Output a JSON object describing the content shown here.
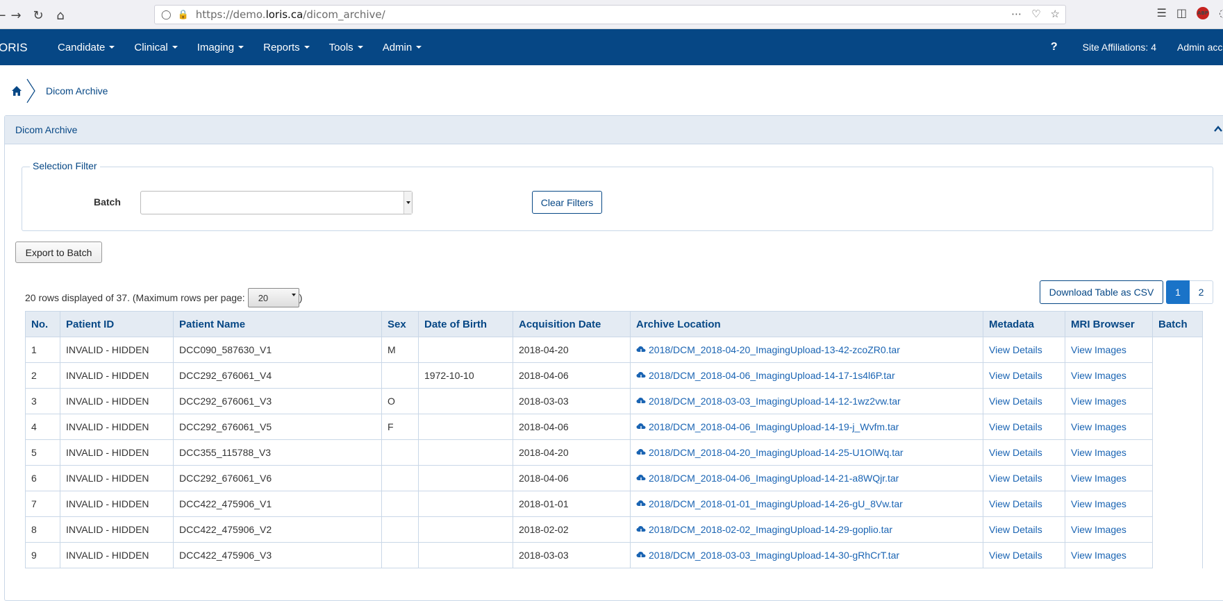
{
  "browser": {
    "url_prefix": "https://demo.",
    "url_domain": "loris.ca",
    "url_path": "/dicom_archive/",
    "abp_label": "ABP"
  },
  "navbar": {
    "brand": "ORIS",
    "menu": [
      {
        "label": "Candidate"
      },
      {
        "label": "Clinical"
      },
      {
        "label": "Imaging"
      },
      {
        "label": "Reports"
      },
      {
        "label": "Tools"
      },
      {
        "label": "Admin"
      }
    ],
    "help": "?",
    "site_affiliations": "Site Affiliations: 4",
    "admin_account": "Admin account"
  },
  "breadcrumb": {
    "current": "Dicom Archive"
  },
  "panel": {
    "title": "Dicom Archive"
  },
  "filter": {
    "legend": "Selection Filter",
    "batch_label": "Batch",
    "batch_value": "",
    "clear_label": "Clear Filters"
  },
  "export_label": "Export to Batch",
  "rows_info": {
    "prefix": "20 rows displayed of 37. (Maximum rows per page:",
    "per_page": "20",
    "suffix": ")"
  },
  "download_csv": "Download Table as CSV",
  "pagination": {
    "pages": [
      "1",
      "2"
    ],
    "active": "1"
  },
  "table": {
    "headers": [
      "No.",
      "Patient ID",
      "Patient Name",
      "Sex",
      "Date of Birth",
      "Acquisition Date",
      "Archive Location",
      "Metadata",
      "MRI Browser",
      "Batch"
    ],
    "rows": [
      {
        "no": "1",
        "patient_id": "INVALID - HIDDEN",
        "patient_name": "DCC090_587630_V1",
        "sex": "M",
        "dob": "",
        "acq_date": "2018-04-20",
        "archive": "2018/DCM_2018-04-20_ImagingUpload-13-42-zcoZR0.tar",
        "metadata": "View Details",
        "mri": "View Images"
      },
      {
        "no": "2",
        "patient_id": "INVALID - HIDDEN",
        "patient_name": "DCC292_676061_V4",
        "sex": "",
        "dob": "1972-10-10",
        "acq_date": "2018-04-06",
        "archive": "2018/DCM_2018-04-06_ImagingUpload-14-17-1s4l6P.tar",
        "metadata": "View Details",
        "mri": "View Images"
      },
      {
        "no": "3",
        "patient_id": "INVALID - HIDDEN",
        "patient_name": "DCC292_676061_V3",
        "sex": "O",
        "dob": "",
        "acq_date": "2018-03-03",
        "archive": "2018/DCM_2018-03-03_ImagingUpload-14-12-1wz2vw.tar",
        "metadata": "View Details",
        "mri": "View Images"
      },
      {
        "no": "4",
        "patient_id": "INVALID - HIDDEN",
        "patient_name": "DCC292_676061_V5",
        "sex": "F",
        "dob": "",
        "acq_date": "2018-04-06",
        "archive": "2018/DCM_2018-04-06_ImagingUpload-14-19-j_Wvfm.tar",
        "metadata": "View Details",
        "mri": "View Images"
      },
      {
        "no": "5",
        "patient_id": "INVALID - HIDDEN",
        "patient_name": "DCC355_115788_V3",
        "sex": "",
        "dob": "",
        "acq_date": "2018-04-20",
        "archive": "2018/DCM_2018-04-20_ImagingUpload-14-25-U1OlWq.tar",
        "metadata": "View Details",
        "mri": "View Images"
      },
      {
        "no": "6",
        "patient_id": "INVALID - HIDDEN",
        "patient_name": "DCC292_676061_V6",
        "sex": "",
        "dob": "",
        "acq_date": "2018-04-06",
        "archive": "2018/DCM_2018-04-06_ImagingUpload-14-21-a8WQjr.tar",
        "metadata": "View Details",
        "mri": "View Images"
      },
      {
        "no": "7",
        "patient_id": "INVALID - HIDDEN",
        "patient_name": "DCC422_475906_V1",
        "sex": "",
        "dob": "",
        "acq_date": "2018-01-01",
        "archive": "2018/DCM_2018-01-01_ImagingUpload-14-26-gU_8Vw.tar",
        "metadata": "View Details",
        "mri": "View Images"
      },
      {
        "no": "8",
        "patient_id": "INVALID - HIDDEN",
        "patient_name": "DCC422_475906_V2",
        "sex": "",
        "dob": "",
        "acq_date": "2018-02-02",
        "archive": "2018/DCM_2018-02-02_ImagingUpload-14-29-goplio.tar",
        "metadata": "View Details",
        "mri": "View Images"
      },
      {
        "no": "9",
        "patient_id": "INVALID - HIDDEN",
        "patient_name": "DCC422_475906_V3",
        "sex": "",
        "dob": "",
        "acq_date": "2018-03-03",
        "archive": "2018/DCM_2018-03-03_ImagingUpload-14-30-gRhCrT.tar",
        "metadata": "View Details",
        "mri": "View Images"
      }
    ]
  },
  "colors": {
    "navbar_bg": "#064785",
    "accent": "#1a73c8",
    "link": "#1a64b3",
    "header_bg": "#e4ebf3"
  }
}
